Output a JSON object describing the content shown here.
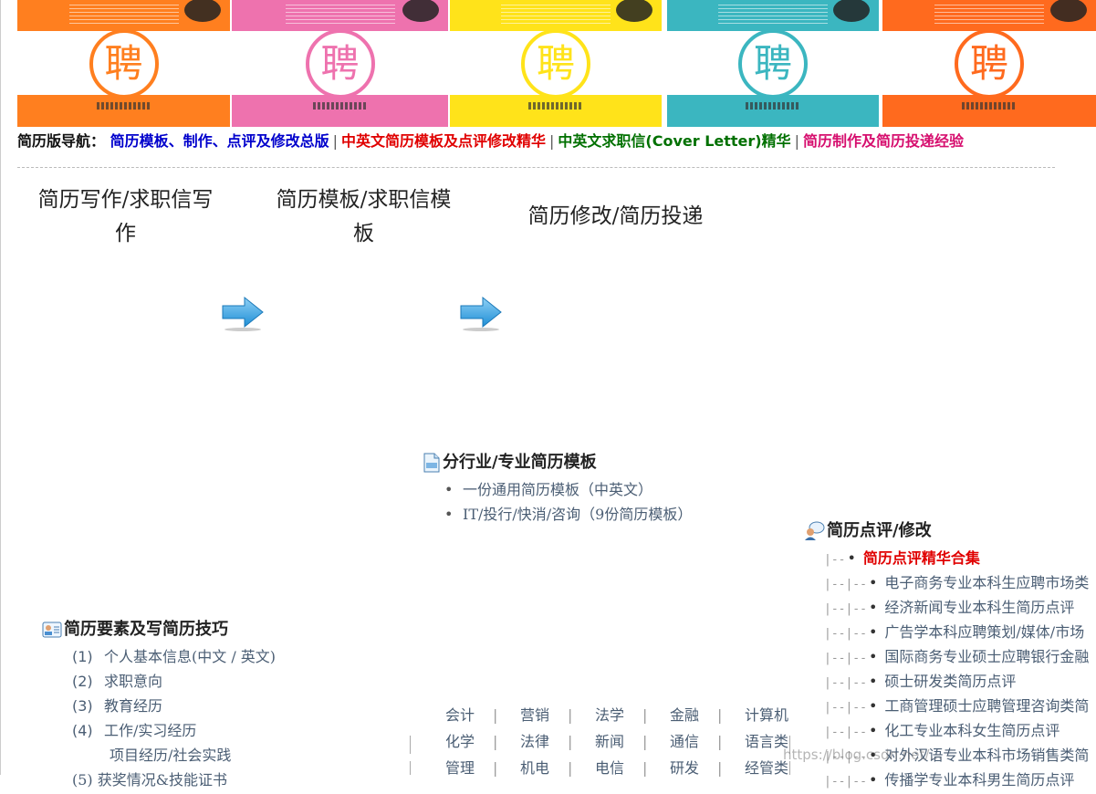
{
  "covers": [
    {
      "top_color": "#ff7f1f",
      "seal_color": "#ff7f1f",
      "bottom_color": "#ff7f1f",
      "char": "聘"
    },
    {
      "top_color": "#ee72ae",
      "seal_color": "#ee72ae",
      "bottom_color": "#ee72ae",
      "char": "聘"
    },
    {
      "top_color": "#ffe31a",
      "seal_color": "#ffe31a",
      "bottom_color": "#ffe31a",
      "char": "聘"
    },
    {
      "top_color": "#3bb6c0",
      "seal_color": "#3bb6c0",
      "bottom_color": "#3bb6c0",
      "char": "聘"
    },
    {
      "top_color": "#ff6a1e",
      "seal_color": "#ff6a1e",
      "bottom_color": "#ff6a1e",
      "char": "聘"
    }
  ],
  "nav": {
    "prefix": "简历版导航：",
    "link1": "简历模板、制作、点评及修改总版",
    "link2": "中英文简历模板及点评修改精华",
    "link3a": "中英文求职信",
    "link3b": "(Cover Letter)",
    "link3c": "精华",
    "link4": "简历制作及简历投递经验",
    "separator": "|"
  },
  "steps": {
    "step1_line1": "简历写作/求职信写",
    "step1_line2": "作",
    "step2_line1": "简历模板/求职信模",
    "step2_line2": "板",
    "step3": "简历修改/简历投递"
  },
  "templates": {
    "title_a": "分行业",
    "title_b": "/ ",
    "title_c": "专业简历模板",
    "items": [
      "一份通用简历模板（中英文）",
      "IT/投行/快消/咨询（9份简历模板）"
    ]
  },
  "tips": {
    "title": "简历要素及写简历技巧",
    "items": [
      {
        "num": "(1)",
        "text": "个人基本信息(中文 /  英文)"
      },
      {
        "num": "(2)",
        "text": "求职意向"
      },
      {
        "num": "(3)",
        "text": "教育经历"
      },
      {
        "num": "(4)",
        "text": "工作/实习经历"
      }
    ],
    "sub": "项目经历/社会实践",
    "partial": "(5)  获奖情况&技能证书"
  },
  "review": {
    "title": "简历点评/修改",
    "highlight": "简历点评精华合集",
    "items": [
      "电子商务专业本科生应聘市场类",
      "经济新闻专业本科生简历点评",
      "广告学本科应聘策划/媒体/市场",
      "国际商务专业硕士应聘银行金融",
      "硕士研发类简历点评",
      "工商管理硕士应聘管理咨询类简",
      "化工专业本科女生简历点评",
      "对外汉语专业本科市场销售类简",
      "传播学专业本科男生简历点评"
    ],
    "tree_top": "|--",
    "tree_child": "|--|--"
  },
  "industries": [
    [
      "会计",
      "营销",
      "法学",
      "金融",
      "计算机"
    ],
    [
      "化学",
      "法律",
      "新闻",
      "通信",
      "语言类"
    ],
    [
      "管理",
      "机电",
      "电信",
      "研发",
      "经管类"
    ]
  ],
  "watermark": "https://blog.csdn.net/..."
}
